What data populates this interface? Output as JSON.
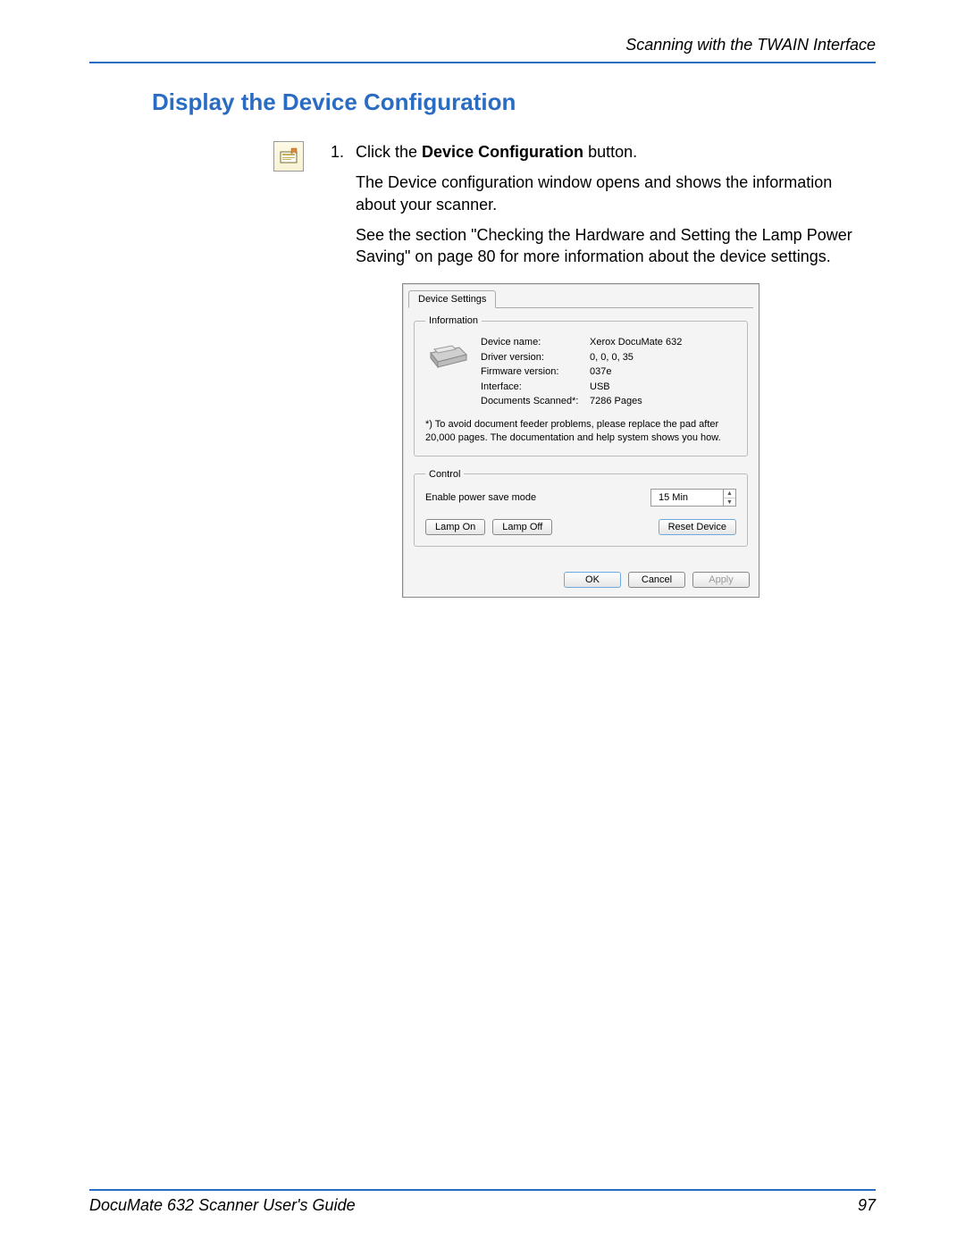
{
  "header": {
    "chapter": "Scanning with the TWAIN Interface"
  },
  "section": {
    "title": "Display the Device Configuration"
  },
  "step": {
    "num": "1.",
    "pre": "Click the ",
    "bold": "Device Configuration",
    "post": " button."
  },
  "paras": {
    "p1": "The Device configuration window opens and shows the information about your scanner.",
    "p2": "See the section \"Checking the Hardware and Setting the Lamp Power Saving\" on page 80 for more information about the device settings."
  },
  "dialog": {
    "tab": "Device Settings",
    "info_legend": "Information",
    "fields": {
      "device_name_lbl": "Device name:",
      "device_name_val": "Xerox DocuMate 632",
      "driver_lbl": "Driver version:",
      "driver_val": "0, 0, 0, 35",
      "firmware_lbl": "Firmware version:",
      "firmware_val": "037e",
      "interface_lbl": "Interface:",
      "interface_val": "USB",
      "docs_lbl": "Documents Scanned*:",
      "docs_val": "7286 Pages"
    },
    "footnote": "*)  To avoid document feeder problems, please replace the pad after 20,000 pages. The documentation and help system shows you how.",
    "ctrl_legend": "Control",
    "power_save_lbl": "Enable power save mode",
    "power_save_val": "15 Min",
    "buttons": {
      "lamp_on": "Lamp On",
      "lamp_off": "Lamp Off",
      "reset": "Reset Device",
      "ok": "OK",
      "cancel": "Cancel",
      "apply": "Apply"
    }
  },
  "footer": {
    "guide": "DocuMate 632 Scanner User's Guide",
    "page": "97"
  }
}
